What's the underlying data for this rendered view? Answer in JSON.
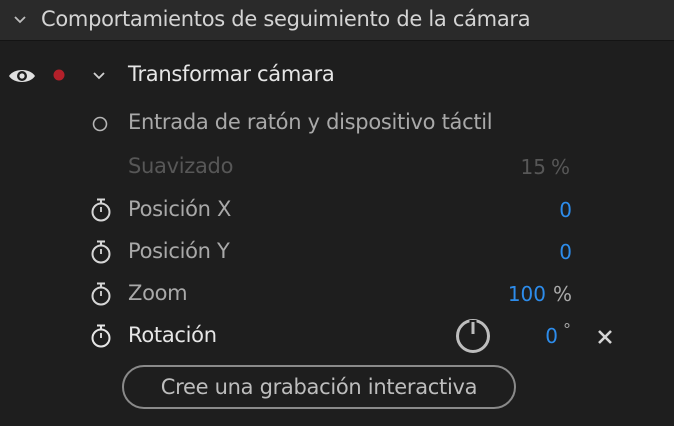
{
  "header": {
    "title": "Comportamientos de seguimiento de la cámara"
  },
  "transform_group": {
    "title": "Transformar cámara",
    "radio_label": "Entrada de ratón y dispositivo táctil",
    "rows": [
      {
        "label": "Suavizado",
        "value": "15",
        "unit": "%"
      },
      {
        "label": "Posición X",
        "value": "0",
        "unit": ""
      },
      {
        "label": "Posición Y",
        "value": "0",
        "unit": ""
      },
      {
        "label": "Zoom",
        "value": "100",
        "unit": "%"
      },
      {
        "label": "Rotación",
        "value": "0",
        "unit": "°"
      }
    ]
  },
  "create_button_label": "Cree una grabación interactiva",
  "colors": {
    "background": "#1e1e1e",
    "header_background": "#2a2a2a",
    "accent_value": "#2d8ceb",
    "record_dot": "#b3202a"
  },
  "icons": [
    "chevron-down-icon",
    "eye-icon",
    "record-dot-icon",
    "radio-button-icon",
    "stopwatch-icon",
    "power-icon",
    "close-icon"
  ]
}
